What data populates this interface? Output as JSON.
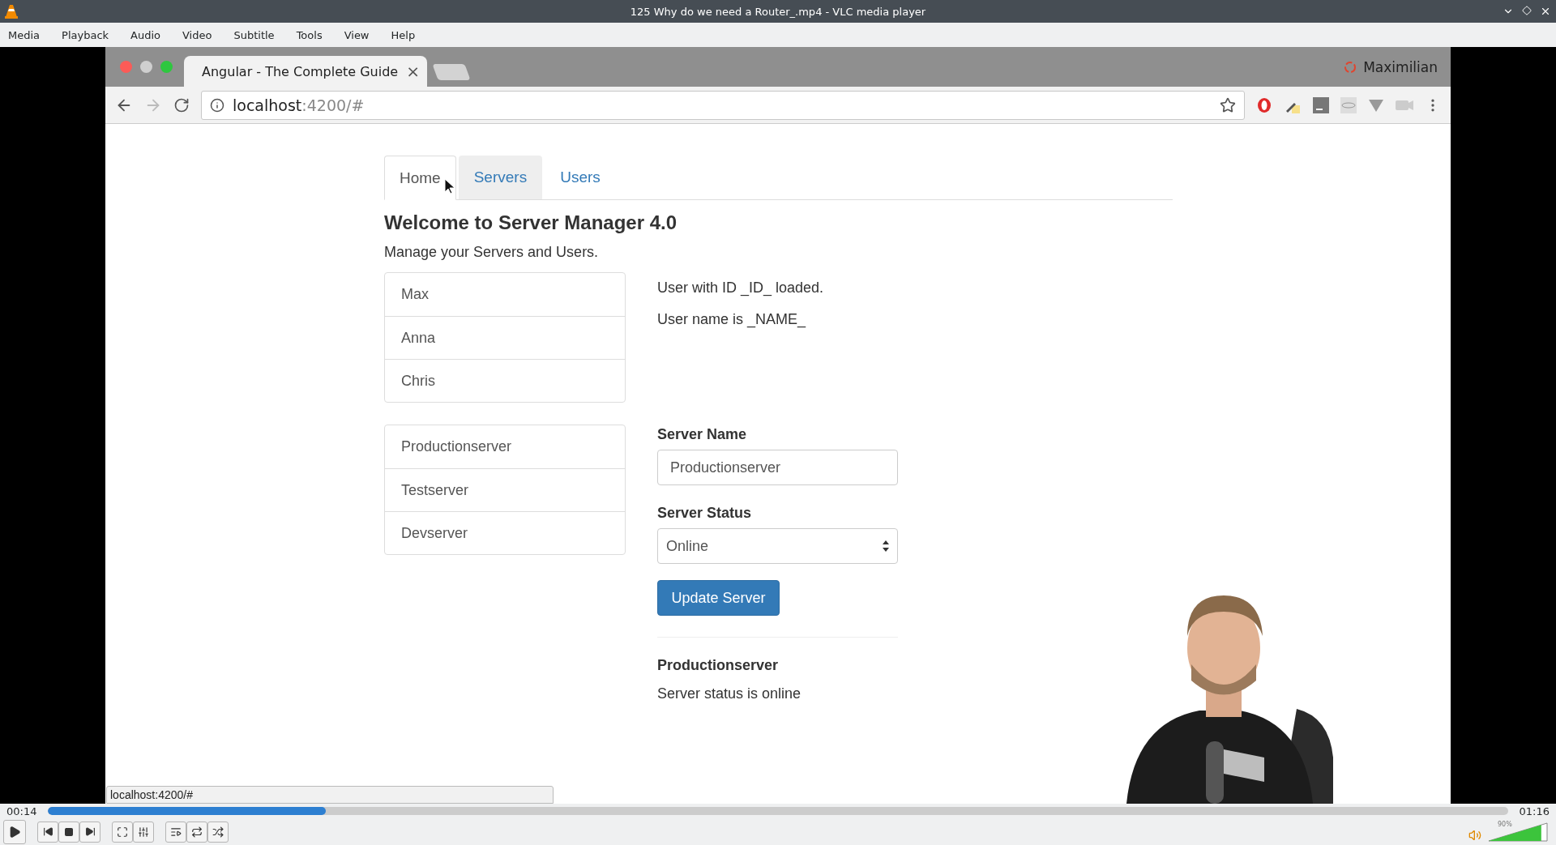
{
  "window": {
    "title": "125 Why do we need a Router_.mp4 - VLC media player"
  },
  "menu": [
    "Media",
    "Playback",
    "Audio",
    "Video",
    "Subtitle",
    "Tools",
    "View",
    "Help"
  ],
  "browser": {
    "tab_title": "Angular - The Complete Guide",
    "tab_close": "×",
    "profile": "Maximilian",
    "url_host": "localhost",
    "url_path": ":4200/#",
    "status_url": "localhost:4200/#"
  },
  "page": {
    "nav": [
      {
        "label": "Home",
        "selected": true
      },
      {
        "label": "Servers",
        "selected": false
      },
      {
        "label": "Users",
        "selected": false
      }
    ],
    "heading": "Welcome to Server Manager 4.0",
    "subheading": "Manage your Servers and Users.",
    "users": [
      "Max",
      "Anna",
      "Chris"
    ],
    "user_info": [
      "User with ID _ID_ loaded.",
      "User name is _NAME_"
    ],
    "servers": [
      "Productionserver",
      "Testserver",
      "Devserver"
    ],
    "form": {
      "name_label": "Server Name",
      "name_value": "Productionserver",
      "status_label": "Server Status",
      "status_value": "Online",
      "button": "Update Server"
    },
    "server_name": "Productionserver",
    "server_status": "Server status is online"
  },
  "player": {
    "elapsed": "00:14",
    "total": "01:16",
    "level": 0.19,
    "volume": {
      "reading": "90%",
      "level": 0.9
    }
  }
}
